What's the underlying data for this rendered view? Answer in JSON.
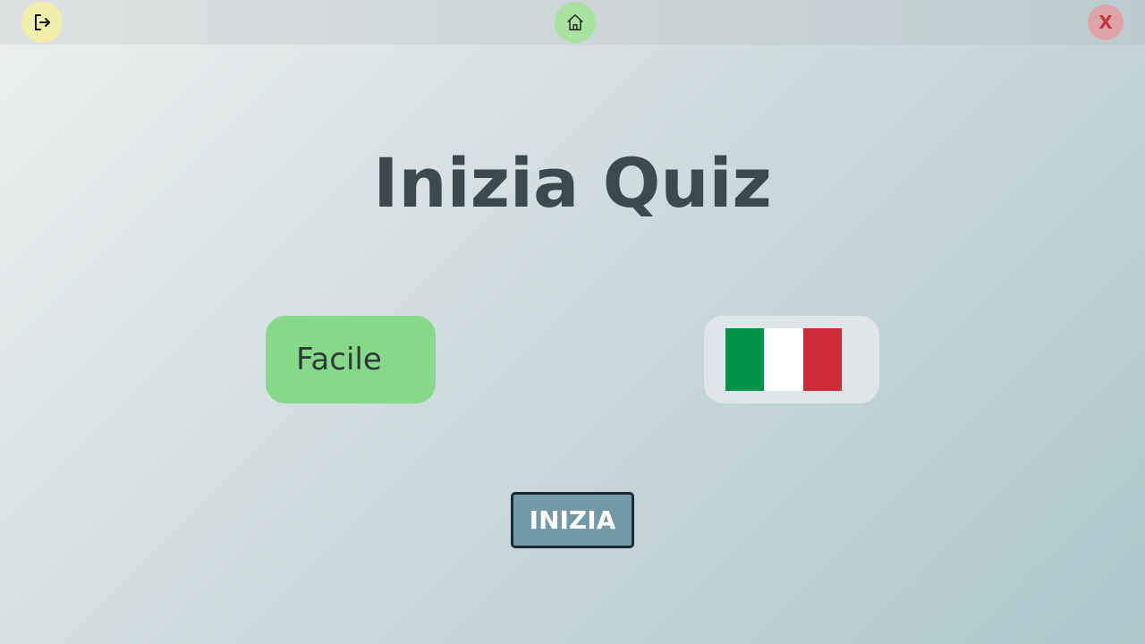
{
  "topbar": {
    "logout_icon": "logout-icon",
    "home_icon": "home-icon",
    "close_label": "X"
  },
  "main": {
    "title": "Inizia Quiz",
    "difficulty_label": "Facile",
    "language_flag": "italy-flag-icon",
    "start_label": "INIZIA"
  },
  "colors": {
    "logout_bg": "#f0eeaa",
    "home_bg": "#a9e2a0",
    "close_bg": "#dda3a7",
    "close_text": "#c0383f",
    "title": "#3a4a4f",
    "difficulty_bg": "#86d98a",
    "language_bg": "#dfe6e8",
    "start_bg": "#7399a8",
    "start_border": "#1e2a33",
    "flag_green": "#009246",
    "flag_white": "#ffffff",
    "flag_red": "#ce2b37"
  }
}
